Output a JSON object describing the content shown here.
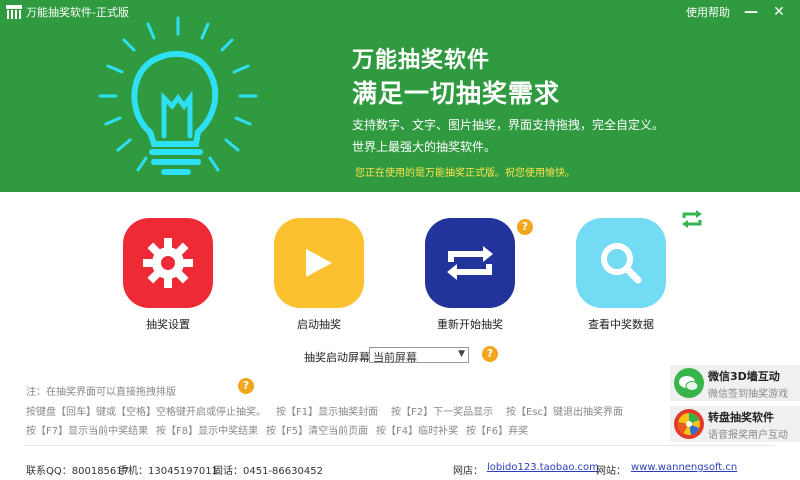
{
  "window": {
    "title": "万能抽奖软件-正式版",
    "help_label": "使用帮助",
    "minimize_glyph": "—",
    "close_glyph": "✕"
  },
  "banner": {
    "slogan_line1": "万能抽奖软件",
    "slogan_line2": "满足一切抽奖需求",
    "desc_line1": "支持数字、文字、图片抽奖，界面支持拖拽，完全自定义。",
    "desc_line2": "世界上最强大的抽奖软件。",
    "notice": "您正在使用的是万能抽奖正式版。祝您使用愉快。",
    "bg_color": "#2f9a3f",
    "bulb_color": "#2ee0f4"
  },
  "tiles": [
    {
      "label": "抽奖设置",
      "icon": "gear-icon",
      "color": "#ee2a37"
    },
    {
      "label": "启动抽奖",
      "icon": "play-icon",
      "color": "#fcc12e"
    },
    {
      "label": "重新开始抽奖",
      "icon": "restart-icon",
      "color": "#22339b"
    },
    {
      "label": "查看中奖数据",
      "icon": "search-icon",
      "color": "#73dbf3"
    }
  ],
  "help_glyph": "?",
  "screen": {
    "label": "抽奖启动屏幕",
    "selected": "当前屏幕"
  },
  "hints": {
    "note": "注：在抽奖界面可以直接拖拽排版",
    "line1": [
      "按键盘【回车】键或【空格】空格键开启或停止抽奖。",
      "按【F1】显示抽奖封面",
      "按【F2】下一奖品显示",
      "按【Esc】键退出抽奖界面"
    ],
    "line2": [
      "按【F7】显示当前中奖结果",
      "按【F8】显示中奖结果",
      "按【F5】清空当前页面",
      "按【F4】临时补奖",
      "按【F6】弃奖"
    ]
  },
  "promos": [
    {
      "title": "微信3D墙互动",
      "subtitle": "微信签到抽奖游戏",
      "icon": "wechat-icon"
    },
    {
      "title": "转盘抽奖软件",
      "subtitle": "语音报奖用户互动",
      "icon": "wheel-icon"
    }
  ],
  "footer": {
    "qq": "联系QQ：800185617",
    "phone": "手机：13045197011",
    "tel": "固话：0451-86630452",
    "shop_label": "网店：",
    "shop_url": "lobido123.taobao.com",
    "site_label": "网站：",
    "site_url": "www.wannengsoft.cn"
  }
}
